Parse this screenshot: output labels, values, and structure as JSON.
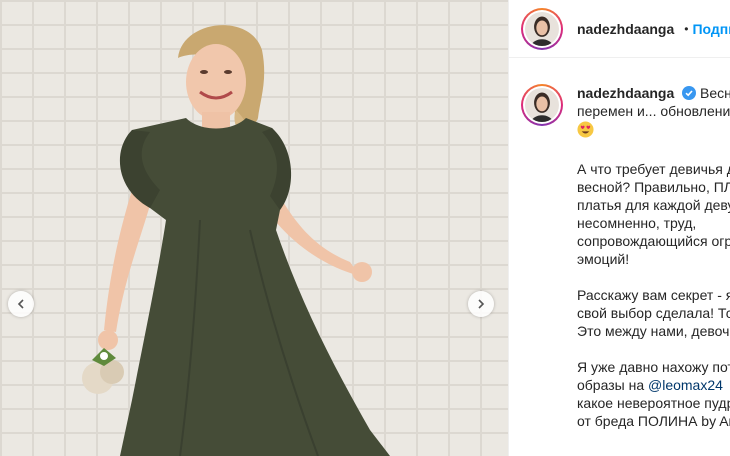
{
  "post": {
    "username": "nadezhdaanga",
    "follow_dot": "•",
    "follow_label": "Подписаться"
  },
  "caption": {
    "username": "nadezhdaanga",
    "first_line_text": "Весна – время",
    "first_line_rest": "перемен и... обновления",
    "p1": [
      "А что требует девичья душа",
      "весной? Правильно, ПЛАТЬЯ,",
      "платья для каждой девушки –",
      "несомненно, труд,",
      "сопровождающийся огромной бурей",
      "эмоций!"
    ],
    "p2": [
      "Расскажу вам секрет - я уже сделала",
      "свой выбор сделала! Тсс...",
      "Это между нами, девочки"
    ],
    "p3_line1": "Я уже давно нахожу потрясающие",
    "p3_line2_prefix": "образы на ",
    "p3_mention": "@leomax24",
    "p3_line3": "какое невероятное пудровое платье",
    "p3_line4": "от бреда ПОЛИНА by Anga"
  },
  "icons": {
    "verified": "verified-badge-icon",
    "emoji": "heart-eyes-emoji-icon",
    "prev": "chevron-left-icon",
    "next": "chevron-right-icon"
  },
  "colors": {
    "follow": "#0095f6",
    "verified": "#3897f0",
    "dress": "#454c37"
  }
}
